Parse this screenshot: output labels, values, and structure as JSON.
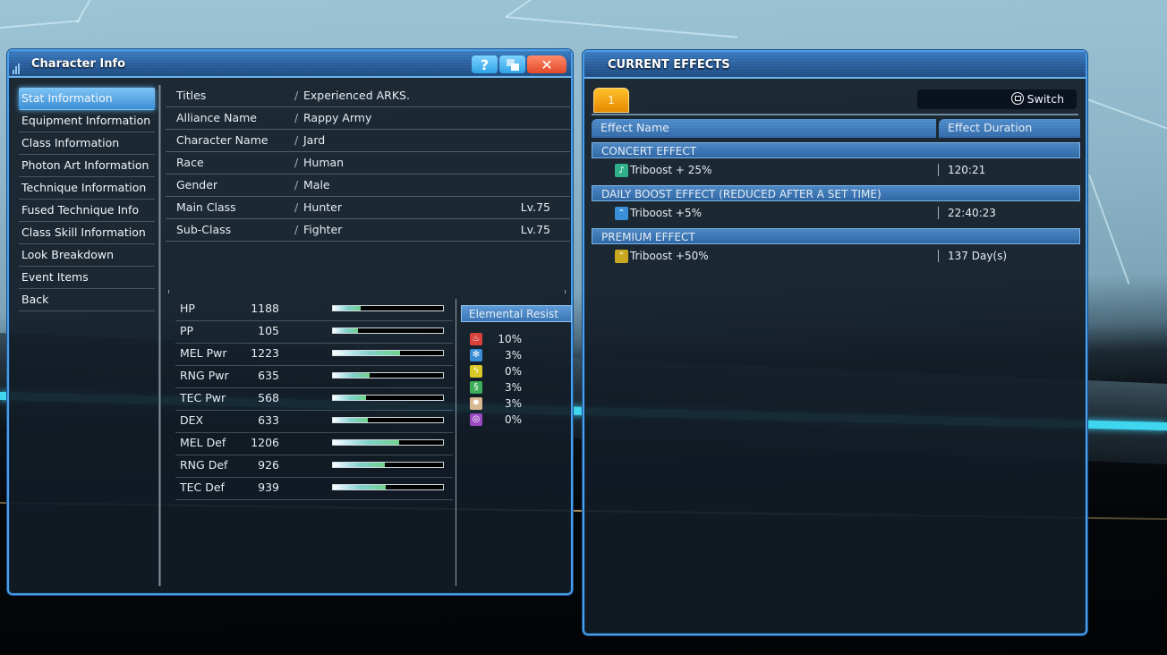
{
  "character_info": {
    "title": "Character Info",
    "buttons": {
      "help": "?",
      "close": "✕"
    },
    "nav": [
      {
        "label": "Stat Information",
        "active": true
      },
      {
        "label": "Equipment Information"
      },
      {
        "label": "Class Information"
      },
      {
        "label": "Photon Art Information"
      },
      {
        "label": "Technique Information"
      },
      {
        "label": "Fused Technique Info"
      },
      {
        "label": "Class Skill Information"
      },
      {
        "label": "Look Breakdown"
      },
      {
        "label": "Event Items"
      },
      {
        "label": "Back"
      }
    ],
    "info": [
      {
        "label": "Titles",
        "value": "Experienced ARKS."
      },
      {
        "label": "Alliance Name",
        "value": "Rappy Army"
      },
      {
        "label": "Character Name",
        "value": "Jard"
      },
      {
        "label": "Race",
        "value": "Human"
      },
      {
        "label": "Gender",
        "value": "Male"
      },
      {
        "label": "Main Class",
        "value": "Hunter",
        "level": "Lv.75"
      },
      {
        "label": "Sub-Class",
        "value": "Fighter",
        "level": "Lv.75"
      }
    ],
    "slash": "/",
    "stats": [
      {
        "name": "HP",
        "value": "1188",
        "fill": 0.25
      },
      {
        "name": "PP",
        "value": "105",
        "fill": 0.23
      },
      {
        "name": "MEL Pwr",
        "value": "1223",
        "fill": 0.61
      },
      {
        "name": "RNG Pwr",
        "value": "635",
        "fill": 0.33
      },
      {
        "name": "TEC Pwr",
        "value": "568",
        "fill": 0.3
      },
      {
        "name": "DEX",
        "value": "633",
        "fill": 0.32
      },
      {
        "name": "MEL Def",
        "value": "1206",
        "fill": 0.6
      },
      {
        "name": "RNG Def",
        "value": "926",
        "fill": 0.47
      },
      {
        "name": "TEC Def",
        "value": "939",
        "fill": 0.48
      }
    ],
    "elemental_resist": {
      "title": "Elemental Resist",
      "items": [
        {
          "element": "fire",
          "value": "10%",
          "color": "#d8403a",
          "glyph": "♨"
        },
        {
          "element": "ice",
          "value": "3%",
          "color": "#3a8ed6",
          "glyph": "✻"
        },
        {
          "element": "lightning",
          "value": "0%",
          "color": "#d8c828",
          "glyph": "ϟ"
        },
        {
          "element": "wind",
          "value": "3%",
          "color": "#3fae5a",
          "glyph": "§"
        },
        {
          "element": "light",
          "value": "3%",
          "color": "#d8b890",
          "glyph": "✸"
        },
        {
          "element": "dark",
          "value": "0%",
          "color": "#9a4ac0",
          "glyph": "◎"
        }
      ]
    }
  },
  "current_effects": {
    "title": "CURRENT EFFECTS",
    "tab": "1",
    "switch_label": "Switch",
    "columns": {
      "name": "Effect Name",
      "duration": "Effect Duration"
    },
    "groups": [
      {
        "title": "CONCERT EFFECT",
        "effects": [
          {
            "name": "Triboost + 25%",
            "duration": "120:21",
            "icon": "music-note",
            "color": "#2fb08a",
            "glyph": "♪"
          }
        ]
      },
      {
        "title": "DAILY BOOST EFFECT (REDUCED AFTER A SET TIME)",
        "effects": [
          {
            "name": "Triboost +5%",
            "duration": "22:40:23",
            "icon": "chevrons-up",
            "color": "#3a90d8",
            "glyph": "⌃"
          }
        ]
      },
      {
        "title": "PREMIUM EFFECT",
        "effects": [
          {
            "name": "Triboost +50%",
            "duration": "137 Day(s)",
            "icon": "chevrons-up",
            "color": "#c8a820",
            "glyph": "⌃"
          }
        ]
      }
    ]
  }
}
